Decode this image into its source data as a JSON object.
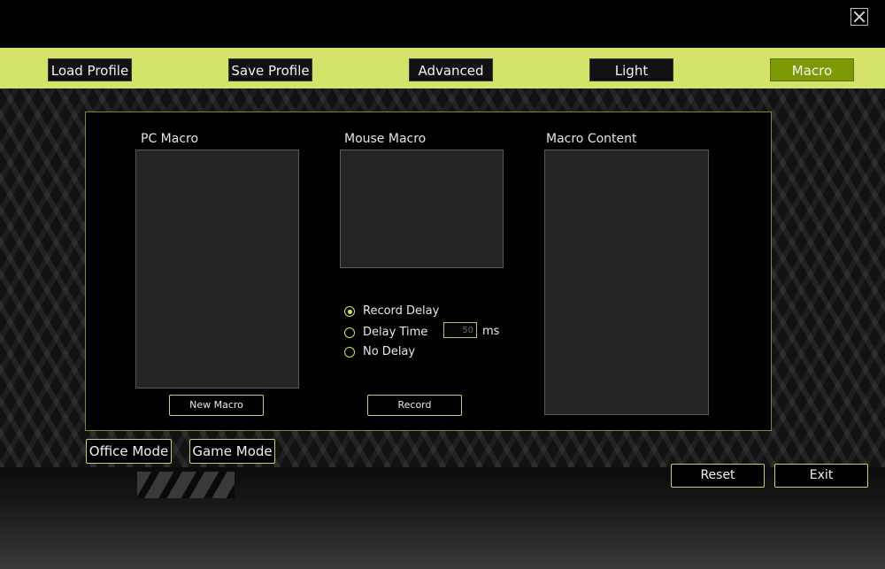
{
  "window": {
    "close_icon": "close-icon"
  },
  "tabs": [
    {
      "label": "Load Profile",
      "active": false
    },
    {
      "label": "Save Profile",
      "active": false
    },
    {
      "label": "Advanced",
      "active": false
    },
    {
      "label": "Light",
      "active": false
    },
    {
      "label": "Macro",
      "active": true
    }
  ],
  "macro_panel": {
    "pc_macro_label": "PC Macro",
    "mouse_macro_label": "Mouse Macro",
    "macro_content_label": "Macro Content",
    "new_macro_label": "New Macro",
    "record_label": "Record",
    "delay_options": [
      {
        "label": "Record Delay",
        "checked": true
      },
      {
        "label": "Delay Time",
        "checked": false
      },
      {
        "label": "No Delay",
        "checked": false
      }
    ],
    "delay_value": "50",
    "delay_unit": "ms"
  },
  "modes": {
    "office_label": "Office Mode",
    "game_label": "Game Mode"
  },
  "footer": {
    "reset_label": "Reset",
    "exit_label": "Exit"
  },
  "colors": {
    "accent": "#d6e36b",
    "active_tab": "#7d9a06"
  }
}
